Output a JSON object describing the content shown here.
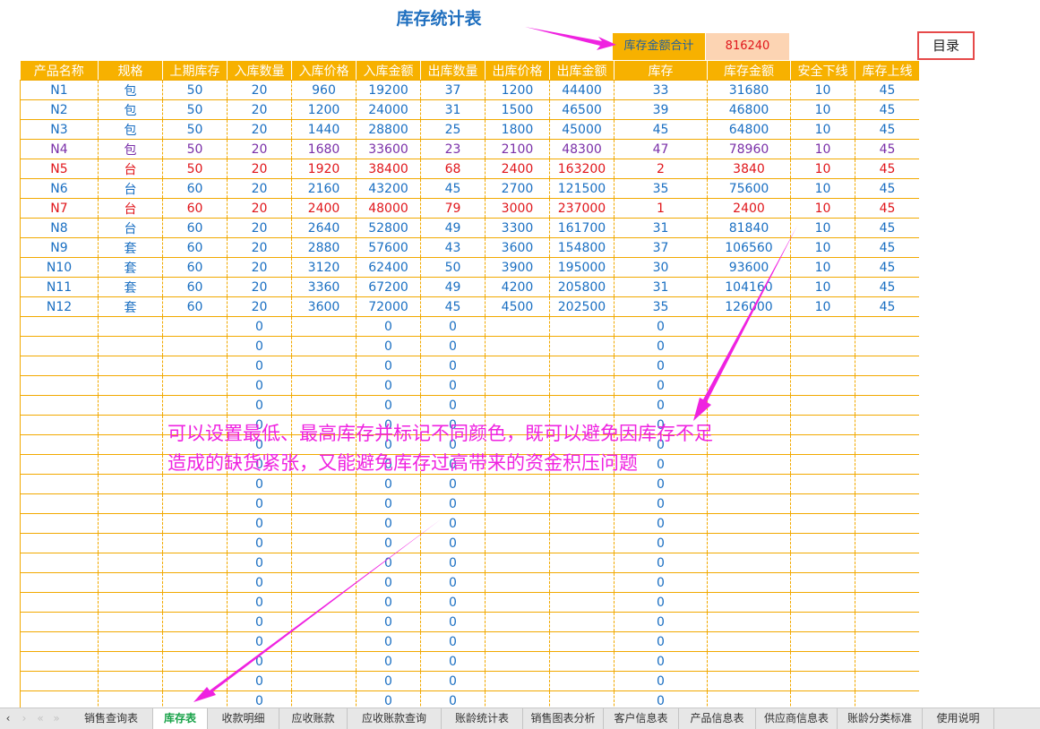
{
  "sheet": {
    "title": "库存统计表",
    "total_label": "库存金额合计",
    "total_value": "816240",
    "toc_button": "目录"
  },
  "table": {
    "headers": [
      "产品名称",
      "规格",
      "上期库存",
      "入库数量",
      "入库价格",
      "入库金额",
      "出库数量",
      "出库价格",
      "出库金额",
      "库存",
      "库存金额",
      "安全下线",
      "库存上线"
    ],
    "rows": [
      {
        "tone": "blue",
        "cells": [
          "N1",
          "包",
          "50",
          "20",
          "960",
          "19200",
          "37",
          "1200",
          "44400",
          "33",
          "31680",
          "10",
          "45"
        ]
      },
      {
        "tone": "blue",
        "cells": [
          "N2",
          "包",
          "50",
          "20",
          "1200",
          "24000",
          "31",
          "1500",
          "46500",
          "39",
          "46800",
          "10",
          "45"
        ]
      },
      {
        "tone": "blue",
        "cells": [
          "N3",
          "包",
          "50",
          "20",
          "1440",
          "28800",
          "25",
          "1800",
          "45000",
          "45",
          "64800",
          "10",
          "45"
        ]
      },
      {
        "tone": "purple",
        "cells": [
          "N4",
          "包",
          "50",
          "20",
          "1680",
          "33600",
          "23",
          "2100",
          "48300",
          "47",
          "78960",
          "10",
          "45"
        ]
      },
      {
        "tone": "red",
        "cells": [
          "N5",
          "台",
          "50",
          "20",
          "1920",
          "38400",
          "68",
          "2400",
          "163200",
          "2",
          "3840",
          "10",
          "45"
        ]
      },
      {
        "tone": "blue",
        "cells": [
          "N6",
          "台",
          "60",
          "20",
          "2160",
          "43200",
          "45",
          "2700",
          "121500",
          "35",
          "75600",
          "10",
          "45"
        ]
      },
      {
        "tone": "red",
        "cells": [
          "N7",
          "台",
          "60",
          "20",
          "2400",
          "48000",
          "79",
          "3000",
          "237000",
          "1",
          "2400",
          "10",
          "45"
        ]
      },
      {
        "tone": "blue",
        "cells": [
          "N8",
          "台",
          "60",
          "20",
          "2640",
          "52800",
          "49",
          "3300",
          "161700",
          "31",
          "81840",
          "10",
          "45"
        ]
      },
      {
        "tone": "blue",
        "cells": [
          "N9",
          "套",
          "60",
          "20",
          "2880",
          "57600",
          "43",
          "3600",
          "154800",
          "37",
          "106560",
          "10",
          "45"
        ]
      },
      {
        "tone": "blue",
        "cells": [
          "N10",
          "套",
          "60",
          "20",
          "3120",
          "62400",
          "50",
          "3900",
          "195000",
          "30",
          "93600",
          "10",
          "45"
        ]
      },
      {
        "tone": "blue",
        "cells": [
          "N11",
          "套",
          "60",
          "20",
          "3360",
          "67200",
          "49",
          "4200",
          "205800",
          "31",
          "104160",
          "10",
          "45"
        ]
      },
      {
        "tone": "blue",
        "cells": [
          "N12",
          "套",
          "60",
          "20",
          "3600",
          "72000",
          "45",
          "4500",
          "202500",
          "35",
          "126000",
          "10",
          "45"
        ]
      }
    ],
    "blank_rows": [
      [
        "",
        "",
        "",
        "0",
        "",
        "0",
        "0",
        "",
        "",
        "0",
        "",
        "",
        ""
      ],
      [
        "",
        "",
        "",
        "0",
        "",
        "0",
        "0",
        "",
        "",
        "0",
        "",
        "",
        ""
      ],
      [
        "",
        "",
        "",
        "0",
        "",
        "0",
        "0",
        "",
        "",
        "0",
        "",
        "",
        ""
      ],
      [
        "",
        "",
        "",
        "0",
        "",
        "0",
        "0",
        "",
        "",
        "0",
        "",
        "",
        ""
      ],
      [
        "",
        "",
        "",
        "0",
        "",
        "0",
        "0",
        "",
        "",
        "0",
        "",
        "",
        ""
      ],
      [
        "",
        "",
        "",
        "0",
        "",
        "0",
        "0",
        "",
        "",
        "0",
        "",
        "",
        ""
      ],
      [
        "",
        "",
        "",
        "0",
        "",
        "0",
        "0",
        "",
        "",
        "0",
        "",
        "",
        ""
      ],
      [
        "",
        "",
        "",
        "0",
        "",
        "0",
        "0",
        "",
        "",
        "0",
        "",
        "",
        ""
      ],
      [
        "",
        "",
        "",
        "0",
        "",
        "0",
        "0",
        "",
        "",
        "0",
        "",
        "",
        ""
      ],
      [
        "",
        "",
        "",
        "0",
        "",
        "0",
        "0",
        "",
        "",
        "0",
        "",
        "",
        ""
      ],
      [
        "",
        "",
        "",
        "0",
        "",
        "0",
        "0",
        "",
        "",
        "0",
        "",
        "",
        ""
      ],
      [
        "",
        "",
        "",
        "0",
        "",
        "0",
        "0",
        "",
        "",
        "0",
        "",
        "",
        ""
      ],
      [
        "",
        "",
        "",
        "0",
        "",
        "0",
        "0",
        "",
        "",
        "0",
        "",
        "",
        ""
      ],
      [
        "",
        "",
        "",
        "0",
        "",
        "0",
        "0",
        "",
        "",
        "0",
        "",
        "",
        ""
      ],
      [
        "",
        "",
        "",
        "0",
        "",
        "0",
        "0",
        "",
        "",
        "0",
        "",
        "",
        ""
      ],
      [
        "",
        "",
        "",
        "0",
        "",
        "0",
        "0",
        "",
        "",
        "0",
        "",
        "",
        ""
      ],
      [
        "",
        "",
        "",
        "0",
        "",
        "0",
        "0",
        "",
        "",
        "0",
        "",
        "",
        ""
      ],
      [
        "",
        "",
        "",
        "0",
        "",
        "0",
        "0",
        "",
        "",
        "0",
        "",
        "",
        ""
      ],
      [
        "",
        "",
        "",
        "0",
        "",
        "0",
        "0",
        "",
        "",
        "0",
        "",
        "",
        ""
      ],
      [
        "",
        "",
        "",
        "0",
        "",
        "0",
        "0",
        "",
        "",
        "0",
        "",
        "",
        ""
      ]
    ]
  },
  "annotation": {
    "line1": "可以设置最低、最高库存并标记不同颜色，既可以避免因库存不足",
    "line2": "造成的缺货紧张，又能避免库存过高带来的资金积压问题",
    "color": "#ef22e0"
  },
  "tabs": {
    "nav": [
      "‹",
      "›",
      "«",
      "»"
    ],
    "items": [
      "销售查询表",
      "库存表",
      "收款明细",
      "应收账款",
      "应收账款查询",
      "账龄统计表",
      "销售图表分析",
      "客户信息表",
      "产品信息表",
      "供应商信息表",
      "账龄分类标准",
      "使用说明"
    ],
    "active": "库存表"
  },
  "colors": {
    "header_fill": "#f7b100",
    "grid_line": "#f2a900",
    "cell_blue": "#1a6fc2",
    "cell_purple": "#7a2fa8",
    "cell_red": "#e0161b",
    "total_fill": "#fcd4b3"
  }
}
